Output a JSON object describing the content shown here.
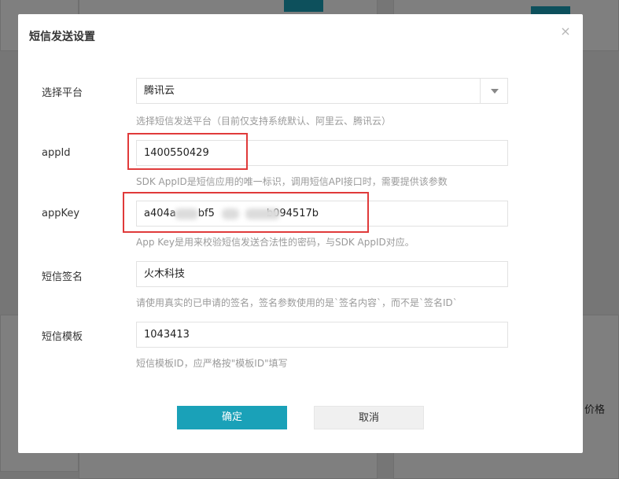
{
  "background": {
    "side_text": "价格"
  },
  "dialog": {
    "title": "短信发送设置",
    "close_glyph": "×"
  },
  "form": {
    "platform": {
      "label": "选择平台",
      "value": "腾讯云",
      "hint": "选择短信发送平台（目前仅支持系统默认、阿里云、腾讯云）"
    },
    "appid": {
      "label": "appId",
      "value": "1400550429",
      "hint": "SDK AppID是短信应用的唯一标识，调用短信API接口时，需要提供该参数"
    },
    "appkey": {
      "label": "appKey",
      "value_visible_parts": [
        "a404a",
        "bf5",
        "b094517b"
      ],
      "hint": "App Key是用来校验短信发送合法性的密码，与SDK AppID对应。"
    },
    "sign": {
      "label": "短信签名",
      "value": "火木科技",
      "hint": "请使用真实的已申请的签名，签名参数使用的是`签名内容`，而不是`签名ID`"
    },
    "template": {
      "label": "短信模板",
      "value": "1043413",
      "hint": "短信模板ID，应严格按\"模板ID\"填写"
    }
  },
  "buttons": {
    "confirm": "确定",
    "cancel": "取消"
  },
  "colors": {
    "primary": "#1aa1b8",
    "highlight": "#e03a3a"
  },
  "icons": {
    "close": "close-icon",
    "dropdown": "chevron-down-icon"
  }
}
